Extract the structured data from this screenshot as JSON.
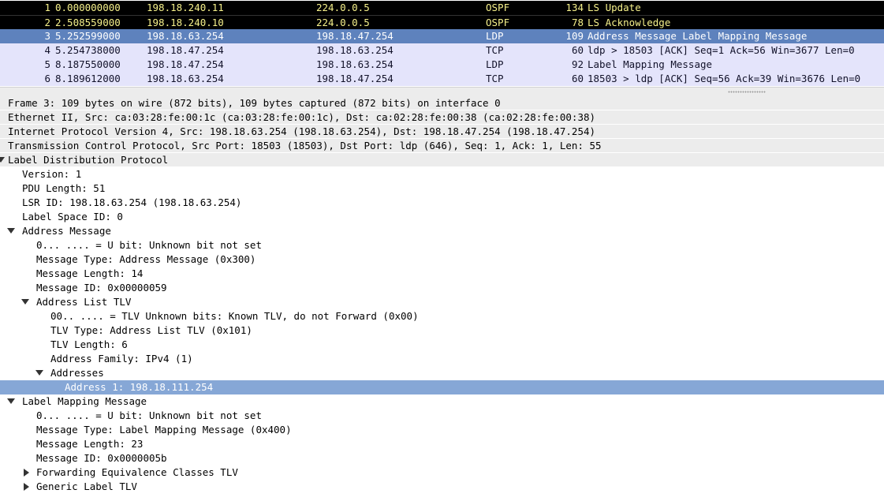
{
  "packet_list": {
    "rows": [
      {
        "no": "1",
        "time": "0.000000000",
        "src": "198.18.240.11",
        "dst": "224.0.0.5",
        "proto": "OSPF",
        "len": "134",
        "info": "LS Update"
      },
      {
        "no": "2",
        "time": "2.508559000",
        "src": "198.18.240.10",
        "dst": "224.0.0.5",
        "proto": "OSPF",
        "len": "78",
        "info": "LS Acknowledge"
      },
      {
        "no": "3",
        "time": "5.252599000",
        "src": "198.18.63.254",
        "dst": "198.18.47.254",
        "proto": "LDP",
        "len": "109",
        "info": "Address Message Label Mapping Message"
      },
      {
        "no": "4",
        "time": "5.254738000",
        "src": "198.18.47.254",
        "dst": "198.18.63.254",
        "proto": "TCP",
        "len": "60",
        "info": "ldp > 18503 [ACK] Seq=1 Ack=56 Win=3677 Len=0"
      },
      {
        "no": "5",
        "time": "8.187550000",
        "src": "198.18.47.254",
        "dst": "198.18.63.254",
        "proto": "LDP",
        "len": "92",
        "info": "Label Mapping Message"
      },
      {
        "no": "6",
        "time": "8.189612000",
        "src": "198.18.63.254",
        "dst": "198.18.47.254",
        "proto": "TCP",
        "len": "60",
        "info": "18503 > ldp [ACK] Seq=56 Ack=39 Win=3676 Len=0"
      }
    ]
  },
  "details": {
    "frame": "Frame 3: 109 bytes on wire (872 bits), 109 bytes captured (872 bits) on interface 0",
    "ethernet": "Ethernet II, Src: ca:03:28:fe:00:1c (ca:03:28:fe:00:1c), Dst: ca:02:28:fe:00:38 (ca:02:28:fe:00:38)",
    "ip": "Internet Protocol Version 4, Src: 198.18.63.254 (198.18.63.254), Dst: 198.18.47.254 (198.18.47.254)",
    "tcp": "Transmission Control Protocol, Src Port: 18503 (18503), Dst Port: ldp (646), Seq: 1, Ack: 1, Len: 55",
    "ldp": {
      "title": "Label Distribution Protocol",
      "version": "Version: 1",
      "pdu_length": "PDU Length: 51",
      "lsr_id": "LSR ID: 198.18.63.254 (198.18.63.254)",
      "label_space_id": "Label Space ID: 0",
      "address_message": {
        "title": "Address Message",
        "u_bit": "0... .... = U bit: Unknown bit not set",
        "msg_type": "Message Type: Address Message (0x300)",
        "msg_length": "Message Length: 14",
        "msg_id": "Message ID: 0x00000059",
        "address_list_tlv": {
          "title": "Address List TLV",
          "unknown_bits": "00.. .... = TLV Unknown bits: Known TLV, do not Forward (0x00)",
          "tlv_type": "TLV Type: Address List TLV (0x101)",
          "tlv_length": "TLV Length: 6",
          "address_family": "Address Family: IPv4 (1)",
          "addresses_title": "Addresses",
          "address_1": "Address 1: 198.18.111.254"
        }
      },
      "label_mapping_message": {
        "title": "Label Mapping Message",
        "u_bit": "0... .... = U bit: Unknown bit not set",
        "msg_type": "Message Type: Label Mapping Message (0x400)",
        "msg_length": "Message Length: 23",
        "msg_id": "Message ID: 0x0000005b",
        "fec_tlv": "Forwarding Equivalence Classes TLV",
        "generic_label_tlv": "Generic Label TLV"
      }
    }
  },
  "colors": {
    "selected_row": "#5e82bd",
    "ospf_row_bg": "#000000",
    "ospf_row_fg": "#f5f08a",
    "tcp_ldp_row_bg": "#e4e4fb",
    "selected_detail": "#86a7d6"
  }
}
